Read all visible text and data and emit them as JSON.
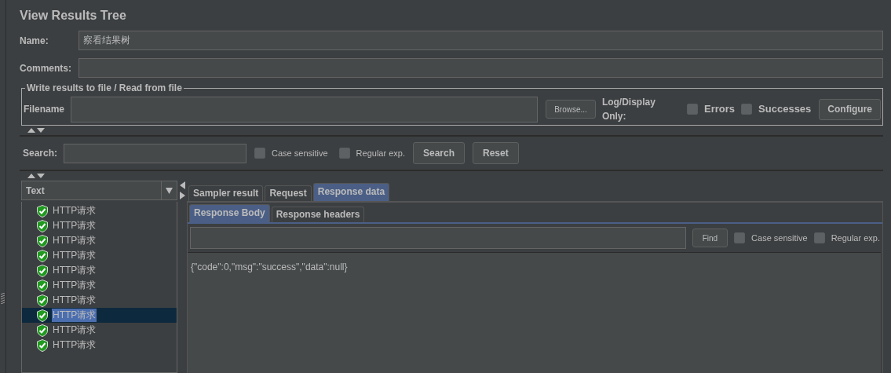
{
  "title": "View Results Tree",
  "name_field": {
    "label": "Name:",
    "value": "察看结果树"
  },
  "comments_field": {
    "label": "Comments:"
  },
  "file_group": {
    "legend": "Write results to file / Read from file",
    "filename_label": "Filename",
    "browse_button": "Browse...",
    "log_label": "Log/Display Only:",
    "options": [
      {
        "label": "Errors",
        "checked": false
      },
      {
        "label": "Successes",
        "checked": false
      }
    ],
    "configure_button": "Configure"
  },
  "search": {
    "label": "Search:",
    "options": [
      {
        "label": "Case sensitive",
        "checked": false
      },
      {
        "label": "Regular exp.",
        "checked": false
      }
    ],
    "search_button": "Search",
    "reset_button": "Reset"
  },
  "renderer_select": {
    "value": "Text"
  },
  "results": [
    {
      "label": "HTTP请求",
      "selected": false
    },
    {
      "label": "HTTP请求",
      "selected": false
    },
    {
      "label": "HTTP请求",
      "selected": false
    },
    {
      "label": "HTTP请求",
      "selected": false
    },
    {
      "label": "HTTP请求",
      "selected": false
    },
    {
      "label": "HTTP请求",
      "selected": false
    },
    {
      "label": "HTTP请求",
      "selected": false
    },
    {
      "label": "HTTP请求",
      "selected": true
    },
    {
      "label": "HTTP请求",
      "selected": false
    },
    {
      "label": "HTTP请求",
      "selected": false
    }
  ],
  "tabs": [
    {
      "label": "Sampler result",
      "selected": false
    },
    {
      "label": "Request",
      "selected": false
    },
    {
      "label": "Response data",
      "selected": true
    }
  ],
  "subtabs": [
    {
      "label": "Response Body",
      "selected": true
    },
    {
      "label": "Response headers",
      "selected": false
    }
  ],
  "find": {
    "button": "Find",
    "options": [
      {
        "label": "Case sensitive",
        "checked": false
      },
      {
        "label": "Regular exp.",
        "checked": false
      }
    ]
  },
  "response_body": "{\"code\":0,\"msg\":\"success\",\"data\":null}"
}
